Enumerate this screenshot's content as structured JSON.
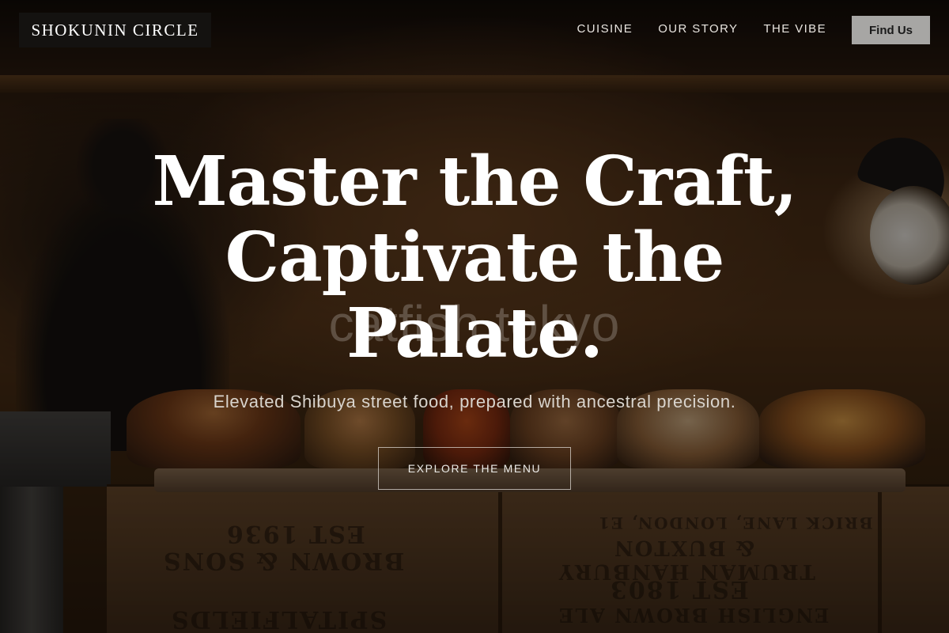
{
  "brand": {
    "name": "SHOKUNIN CIRCLE"
  },
  "nav": {
    "items": [
      {
        "label": "CUISINE"
      },
      {
        "label": "OUR STORY"
      },
      {
        "label": "THE VIBE"
      }
    ],
    "cta_label": "Find Us"
  },
  "hero": {
    "headline_lines": [
      "Master the Craft,",
      "Captivate the",
      "Palate."
    ],
    "watermark": "catfish tokyo",
    "subline": "Elevated Shibuya street food, prepared with ancestral precision.",
    "cta_label": "EXPLORE THE MENU"
  },
  "background": {
    "crate_text_left": [
      "EST 1936",
      "BROWN & SONS",
      "SPITALFIELDS"
    ],
    "crate_text_right": [
      "BRICK LANE, LONDON, E1",
      "& BUXTON",
      "TRUMAN HANBURY",
      "EST 1803",
      "ENGLISH BROWN ALE"
    ]
  }
}
